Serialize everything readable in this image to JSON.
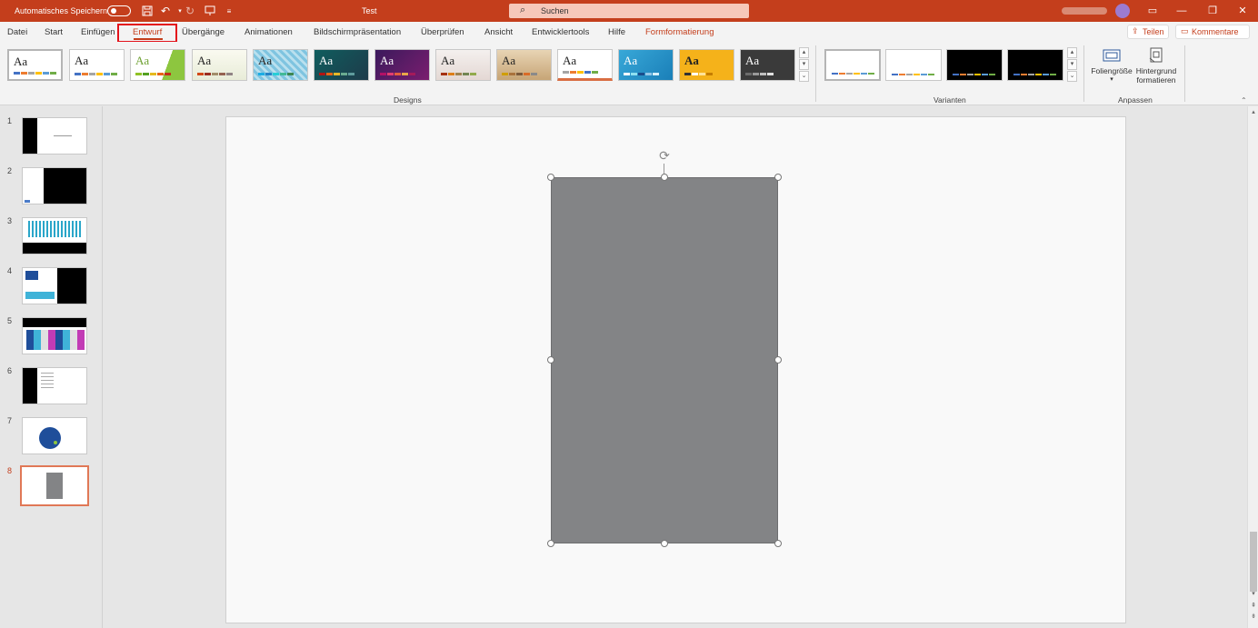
{
  "titlebar": {
    "autosave_label": "Automatisches Speichern",
    "doc_title": "Test",
    "search_placeholder": "Suchen"
  },
  "tabs": [
    {
      "label": "Datei"
    },
    {
      "label": "Start"
    },
    {
      "label": "Einfügen"
    },
    {
      "label": "Entwurf"
    },
    {
      "label": "Übergänge"
    },
    {
      "label": "Animationen"
    },
    {
      "label": "Bildschirmpräsentation"
    },
    {
      "label": "Überprüfen"
    },
    {
      "label": "Ansicht"
    },
    {
      "label": "Entwicklertools"
    },
    {
      "label": "Hilfe"
    },
    {
      "label": "Formformatierung"
    }
  ],
  "active_tab": "Entwurf",
  "share_label": "Teilen",
  "comments_label": "Kommentare",
  "ribbon": {
    "designs_label": "Designs",
    "variants_label": "Varianten",
    "customize_label": "Anpassen",
    "slide_size_label": "Foliengröße",
    "format_bg_line1": "Hintergrund",
    "format_bg_line2": "formatieren",
    "theme_glyph": "Aa"
  },
  "slides": [
    {
      "number": "1"
    },
    {
      "number": "2"
    },
    {
      "number": "3"
    },
    {
      "number": "4"
    },
    {
      "number": "5"
    },
    {
      "number": "6"
    },
    {
      "number": "7"
    },
    {
      "number": "8"
    }
  ],
  "current_slide": "8",
  "colors": {
    "accent": "#c43e1c",
    "shape_fill": "#838486",
    "highlight": "#e3131b"
  }
}
